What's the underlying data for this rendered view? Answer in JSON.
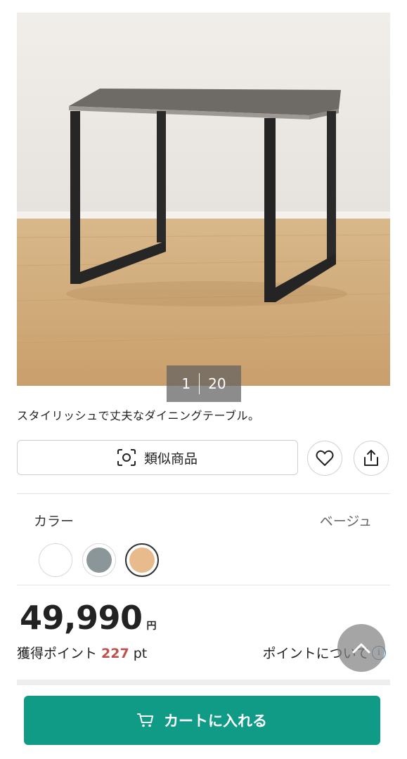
{
  "gallery": {
    "current": "1",
    "total": "20",
    "image": "dining-table-photo"
  },
  "product": {
    "description": "スタイリッシュで丈夫なダイニングテーブル。"
  },
  "actions": {
    "similar_label": "類似商品",
    "similar_icon": "camera-scan-icon",
    "favorite_icon": "heart-icon",
    "share_icon": "share-icon"
  },
  "color": {
    "label": "カラー",
    "selected": "ベージュ",
    "swatches": [
      {
        "name": "white",
        "hex": "#ffffff"
      },
      {
        "name": "gray",
        "hex": "#8a9698"
      },
      {
        "name": "beige",
        "hex": "#e8bb8d",
        "selected": true
      }
    ]
  },
  "price": {
    "value": "49,990",
    "currency": "円"
  },
  "points": {
    "label": "獲得ポイント",
    "value": "227",
    "unit": "pt",
    "about_label": "ポイントについて",
    "info_icon": "info-icon"
  },
  "scroll_top_icon": "chevron-up-icon",
  "cart": {
    "label": "カートに入れる",
    "icon": "cart-icon",
    "color": "#109b86"
  }
}
